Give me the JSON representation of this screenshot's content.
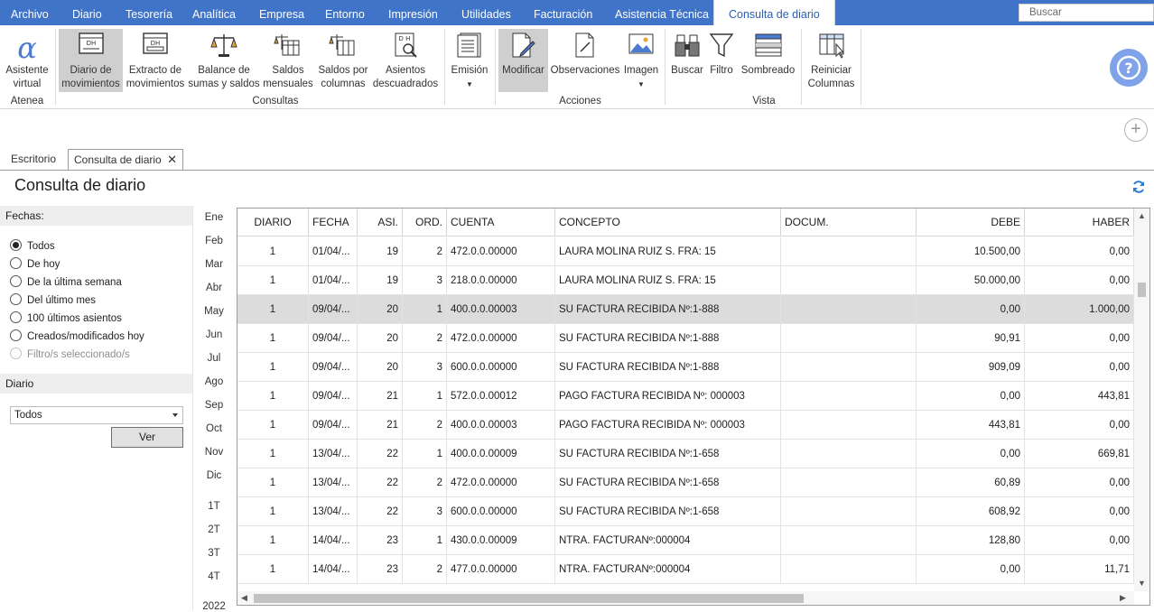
{
  "menubar": {
    "items": [
      "Archivo",
      "Diario",
      "Tesorería",
      "Analítica",
      "Empresa",
      "Entorno",
      "Impresión",
      "Utilidades",
      "Facturación",
      "Asistencia Técnica",
      "Consulta de diario"
    ],
    "active": "Consulta de diario",
    "search_placeholder": "Buscar"
  },
  "ribbon": {
    "groups": {
      "atenea": "Atenea",
      "consultas": "Consultas",
      "acciones": "Acciones",
      "vista": "Vista"
    },
    "buttons": {
      "asistente": [
        "Asistente",
        "virtual"
      ],
      "diario_mov": [
        "Diario de",
        "movimientos"
      ],
      "extracto": [
        "Extracto de",
        "movimientos"
      ],
      "balance": [
        "Balance de",
        "sumas y saldos"
      ],
      "saldos_mensuales": [
        "Saldos",
        "mensuales"
      ],
      "saldos_columnas": [
        "Saldos por",
        "columnas"
      ],
      "asientos_desc": [
        "Asientos",
        "descuadrados"
      ],
      "emision": "Emisión",
      "modificar": "Modificar",
      "observaciones": "Observaciones",
      "imagen": "Imagen",
      "buscar": "Buscar",
      "filtro": "Filtro",
      "sombreado": "Sombreado",
      "reiniciar": [
        "Reiniciar",
        "Columnas"
      ]
    }
  },
  "tabs": {
    "escritorio": "Escritorio",
    "consulta": "Consulta de diario"
  },
  "page_title": "Consulta de diario",
  "sidebar": {
    "fechas_label": "Fechas:",
    "options": [
      "Todos",
      "De hoy",
      "De la última semana",
      "Del último mes",
      "100 últimos asientos",
      "Creados/modificados hoy",
      "Filtro/s seleccionado/s"
    ],
    "selected": "Todos",
    "diario_label": "Diario",
    "diario_value": "Todos",
    "ver_button": "Ver"
  },
  "periods": {
    "months": [
      "Ene",
      "Feb",
      "Mar",
      "Abr",
      "May",
      "Jun",
      "Jul",
      "Ago",
      "Sep",
      "Oct",
      "Nov",
      "Dic"
    ],
    "quarters": [
      "1T",
      "2T",
      "3T",
      "4T"
    ],
    "year": "2022"
  },
  "table": {
    "columns": [
      "DIARIO",
      "FECHA",
      "ASI.",
      "ORD.",
      "CUENTA",
      "CONCEPTO",
      "DOCUM.",
      "DEBE",
      "HABER"
    ],
    "rows": [
      [
        "1",
        "01/04/...",
        "19",
        "2",
        "472.0.0.00000",
        "LAURA MOLINA RUIZ S. FRA:  15",
        "",
        "10.500,00",
        "0,00"
      ],
      [
        "1",
        "01/04/...",
        "19",
        "3",
        "218.0.0.00000",
        "LAURA MOLINA RUIZ S. FRA:  15",
        "",
        "50.000,00",
        "0,00"
      ],
      [
        "1",
        "09/04/...",
        "20",
        "1",
        "400.0.0.00003",
        "SU FACTURA RECIBIDA Nº:1-888",
        "",
        "0,00",
        "1.000,00"
      ],
      [
        "1",
        "09/04/...",
        "20",
        "2",
        "472.0.0.00000",
        "SU FACTURA RECIBIDA Nº:1-888",
        "",
        "90,91",
        "0,00"
      ],
      [
        "1",
        "09/04/...",
        "20",
        "3",
        "600.0.0.00000",
        "SU FACTURA RECIBIDA Nº:1-888",
        "",
        "909,09",
        "0,00"
      ],
      [
        "1",
        "09/04/...",
        "21",
        "1",
        "572.0.0.00012",
        "PAGO FACTURA RECIBIDA Nº: 000003",
        "",
        "0,00",
        "443,81"
      ],
      [
        "1",
        "09/04/...",
        "21",
        "2",
        "400.0.0.00003",
        "PAGO FACTURA RECIBIDA Nº: 000003",
        "",
        "443,81",
        "0,00"
      ],
      [
        "1",
        "13/04/...",
        "22",
        "1",
        "400.0.0.00009",
        "SU FACTURA RECIBIDA Nº:1-658",
        "",
        "0,00",
        "669,81"
      ],
      [
        "1",
        "13/04/...",
        "22",
        "2",
        "472.0.0.00000",
        "SU FACTURA RECIBIDA Nº:1-658",
        "",
        "60,89",
        "0,00"
      ],
      [
        "1",
        "13/04/...",
        "22",
        "3",
        "600.0.0.00000",
        "SU FACTURA RECIBIDA Nº:1-658",
        "",
        "608,92",
        "0,00"
      ],
      [
        "1",
        "14/04/...",
        "23",
        "1",
        "430.0.0.00009",
        "NTRA. FACTURANº:000004",
        "",
        "128,80",
        "0,00"
      ],
      [
        "1",
        "14/04/...",
        "23",
        "2",
        "477.0.0.00000",
        "NTRA. FACTURANº:000004",
        "",
        "0,00",
        "11,71"
      ]
    ],
    "selected_row": 2
  },
  "colors": {
    "menubar": "#3f74c9",
    "accent": "#2b5fb4",
    "selected_row": "#dcdcdc",
    "help": "#7fa2e8"
  },
  "icons": {
    "help": "question-circle-icon",
    "add": "plus-circle-icon",
    "refresh": "refresh-icon",
    "close_tab": "close-icon"
  }
}
